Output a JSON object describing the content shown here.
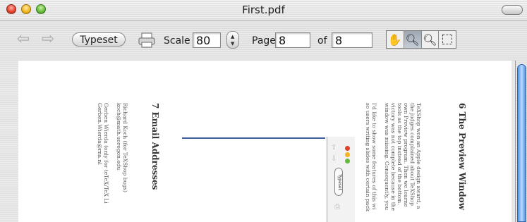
{
  "window": {
    "title": "First.pdf"
  },
  "toolbar": {
    "typeset_label": "Typeset",
    "scale_label": "Scale",
    "scale_value": "80",
    "page_label": "Page",
    "page_value": "8",
    "of_label": "of",
    "of_value": "8"
  },
  "icons": {
    "back": "back-arrow-icon",
    "forward": "forward-arrow-icon",
    "print": "printer-icon",
    "tools": [
      "hand-tool-icon",
      "magnify-tool-icon",
      "zoom-tool-icon",
      "select-tool-icon"
    ]
  },
  "document": {
    "section7_heading": "7   Email Addresses",
    "section7_lines": [
      "Richard Koch (for TeXShop bugs)",
      "koch@math.uoregon.edu",
      "",
      "Gerben Wierda (only for teTeX/TeX Li",
      "Gerben.Wierda@rna.nl"
    ],
    "section6_heading": "6   The Preview Window",
    "section6_lines": [
      "TeXShop won an Apple design award, a",
      "the judges complained about TeXShop",
      "own Preview program.  Then we learne",
      "tools as the top instead of the bottom.",
      "victory was not complete because in the",
      "window was missing.  Consequently, you",
      "",
      "I'd like to show some features of this wi",
      "so users writing slides with certain pack"
    ],
    "mini_typeset_label": "Typeset"
  },
  "colors": {
    "accent": "#3b5f9c",
    "scroll_thumb": "#4d8fe0"
  }
}
